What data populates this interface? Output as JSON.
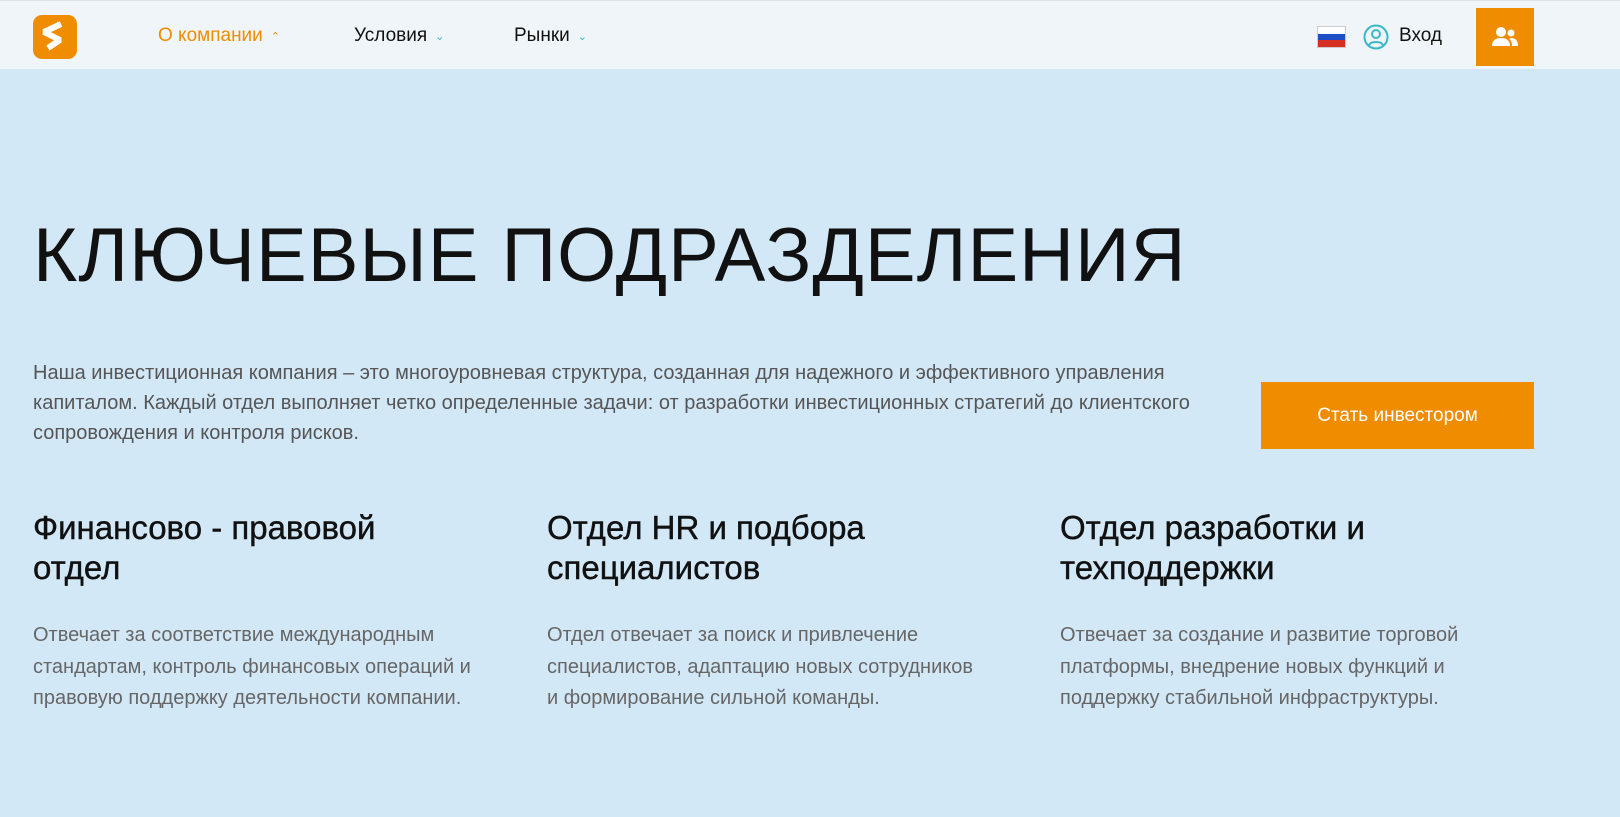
{
  "header": {
    "nav": [
      {
        "label": "О компании",
        "active": true
      },
      {
        "label": "Условия"
      },
      {
        "label": "Рынки"
      }
    ],
    "login": "Вход"
  },
  "colors": {
    "accent": "#f08c00",
    "bg": "#d3e8f7",
    "teal": "#3bb8c8"
  },
  "main": {
    "title": "КЛЮЧЕВЫЕ ПОДРАЗДЕЛЕНИЯ",
    "intro": "Наша инвестиционная компания – это многоуровневая структура, созданная для надежного и эффективного управления капиталом. Каждый отдел выполняет четко определенные задачи: от разработки инвестиционных стратегий до клиентского сопровождения и контроля рисков.",
    "cta": "Стать инвестором",
    "departments": [
      {
        "title": "Финансово - правовой отдел",
        "text": "Отвечает за соответствие международным стандартам, контроль финансовых операций и правовую поддержку деятельности компании."
      },
      {
        "title": "Отдел HR и подбора специалистов",
        "text": "Отдел отвечает за поиск и привлечение специалистов, адаптацию новых сотрудников и формирование сильной команды."
      },
      {
        "title": "Отдел разработки и техподдержки",
        "text": "Отвечает за создание и развитие торговой платформы, внедрение новых функций и поддержку стабильной инфраструктуры."
      }
    ]
  }
}
